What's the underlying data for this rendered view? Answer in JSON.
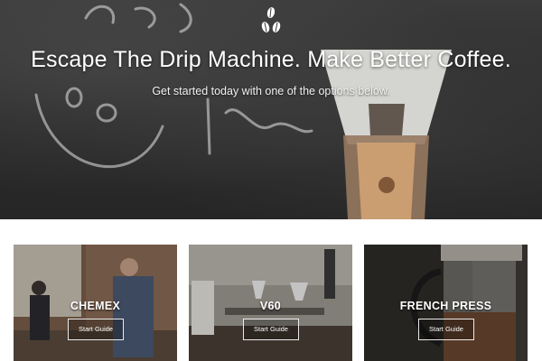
{
  "hero": {
    "title": "Escape The Drip Machine. Make Better Coffee.",
    "subtitle": "Get started today with one of the options below.",
    "logo_icon": "coffee-beans-icon"
  },
  "guides": [
    {
      "title": "CHEMEX",
      "button_label": "Start Guide"
    },
    {
      "title": "V60",
      "button_label": "Start Guide"
    },
    {
      "title": "FRENCH PRESS",
      "button_label": "Start Guide"
    }
  ],
  "colors": {
    "hero_background": "#2b2b2b",
    "hero_text": "#ffffff",
    "button_border": "#ffffff"
  }
}
